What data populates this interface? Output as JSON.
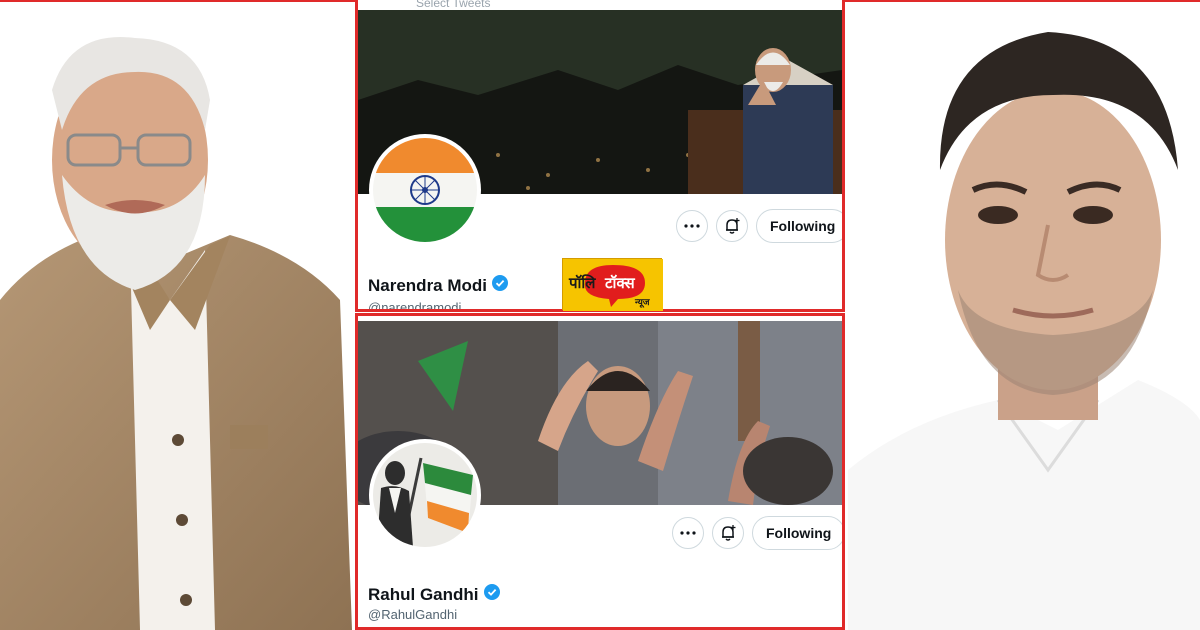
{
  "colors": {
    "frame": "#e02a2a",
    "verified": "#1d9bf0",
    "text": "#0f1419",
    "muted": "#536471",
    "logo_bg": "#f6c400",
    "logo_accent": "#e11d1d"
  },
  "profiles": [
    {
      "tweets_peek": "Select Tweets",
      "name": "Narendra Modi",
      "handle": "@narendramodi",
      "follow_label": "Following",
      "avatar_description": "india-flag-avatar",
      "banner_description": "night-rally-banner"
    },
    {
      "name": "Rahul Gandhi",
      "handle": "@RahulGandhi",
      "follow_label": "Following",
      "avatar_description": "flag-bearer-portrait-avatar",
      "banner_description": "crowd-greeting-banner"
    }
  ],
  "logo": {
    "text": "पॉलिटॉक्स",
    "sub": "न्यूज"
  },
  "icons": [
    "more-icon",
    "bell-plus-icon",
    "verified-badge-icon"
  ]
}
